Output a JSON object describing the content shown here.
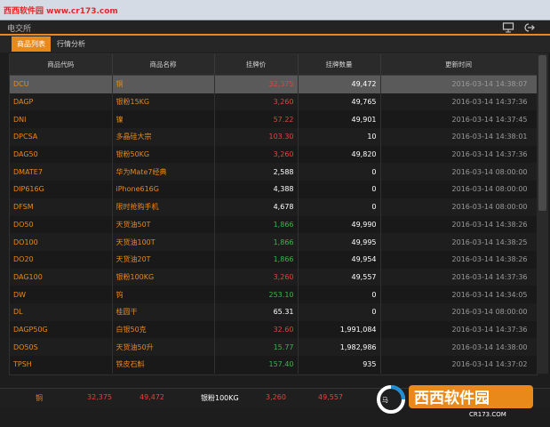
{
  "watermark": {
    "top_text": "西西软件园 www.cr173.com",
    "logo_text": "西西软件园",
    "logo_sub": "CR173.COM",
    "logo_prefix": "马"
  },
  "app": {
    "title": "电交所"
  },
  "tabs": [
    {
      "label": "商品列表",
      "active": true
    },
    {
      "label": "行情分析",
      "active": false
    }
  ],
  "table": {
    "columns": [
      "商品代码",
      "商品名称",
      "挂牌价",
      "挂牌数量",
      "更新时间"
    ],
    "rows": [
      {
        "code": "DCU",
        "name": "铜",
        "price": "32,375",
        "price_color": "red",
        "qty": "49,472",
        "time": "2016-03-14 14:38:07"
      },
      {
        "code": "DAGP",
        "name": "银粉15KG",
        "price": "3,260",
        "price_color": "red",
        "qty": "49,765",
        "time": "2016-03-14 14:37:36"
      },
      {
        "code": "DNI",
        "name": "镍",
        "price": "57.22",
        "price_color": "red",
        "qty": "49,901",
        "time": "2016-03-14 14:37:45"
      },
      {
        "code": "DPCSA",
        "name": "多晶硅大宗",
        "price": "103.30",
        "price_color": "red",
        "qty": "10",
        "time": "2016-03-14 14:38:01"
      },
      {
        "code": "DAG50",
        "name": "银粉50KG",
        "price": "3,260",
        "price_color": "red",
        "qty": "49,820",
        "time": "2016-03-14 14:37:36"
      },
      {
        "code": "DMATE7",
        "name": "华为Mate7经典",
        "price": "2,588",
        "price_color": "white",
        "qty": "0",
        "time": "2016-03-14 08:00:00"
      },
      {
        "code": "DIP616G",
        "name": "iPhone616G",
        "price": "4,388",
        "price_color": "white",
        "qty": "0",
        "time": "2016-03-14 08:00:00"
      },
      {
        "code": "DFSM",
        "name": "限时抢购手机",
        "price": "4,678",
        "price_color": "white",
        "qty": "0",
        "time": "2016-03-14 08:00:00"
      },
      {
        "code": "DO50",
        "name": "天货油50T",
        "price": "1,866",
        "price_color": "green",
        "qty": "49,990",
        "time": "2016-03-14 14:38:26"
      },
      {
        "code": "DO100",
        "name": "天货油100T",
        "price": "1,866",
        "price_color": "green",
        "qty": "49,995",
        "time": "2016-03-14 14:38:25"
      },
      {
        "code": "DO20",
        "name": "天货油20T",
        "price": "1,866",
        "price_color": "green",
        "qty": "49,954",
        "time": "2016-03-14 14:38:26"
      },
      {
        "code": "DAG100",
        "name": "银粉100KG",
        "price": "3,260",
        "price_color": "red",
        "qty": "49,557",
        "time": "2016-03-14 14:37:36"
      },
      {
        "code": "DW",
        "name": "钨",
        "price": "253.10",
        "price_color": "green",
        "qty": "0",
        "time": "2016-03-14 14:34:05"
      },
      {
        "code": "DL",
        "name": "桂圆干",
        "price": "65.31",
        "price_color": "white",
        "qty": "0",
        "time": "2016-03-14 08:00:00"
      },
      {
        "code": "DAGP50G",
        "name": "白银50克",
        "price": "32.60",
        "price_color": "red",
        "qty": "1,991,084",
        "time": "2016-03-14 14:37:36"
      },
      {
        "code": "DO50S",
        "name": "天货油50升",
        "price": "15.77",
        "price_color": "green",
        "qty": "1,982,986",
        "time": "2016-03-14 14:38:00"
      },
      {
        "code": "TPSH",
        "name": "铁皮石斛",
        "price": "157.40",
        "price_color": "green",
        "qty": "935",
        "time": "2016-03-14 14:37:02"
      }
    ]
  },
  "footer": {
    "item1_name": "铜",
    "item1_price": "32,375",
    "item1_qty": "49,472",
    "item2_name": "银粉100KG",
    "item2_price": "3,260",
    "item2_qty": "49,557"
  },
  "colors": {
    "accent": "#e8891a",
    "red": "#e0463a",
    "green": "#3bb54a"
  }
}
